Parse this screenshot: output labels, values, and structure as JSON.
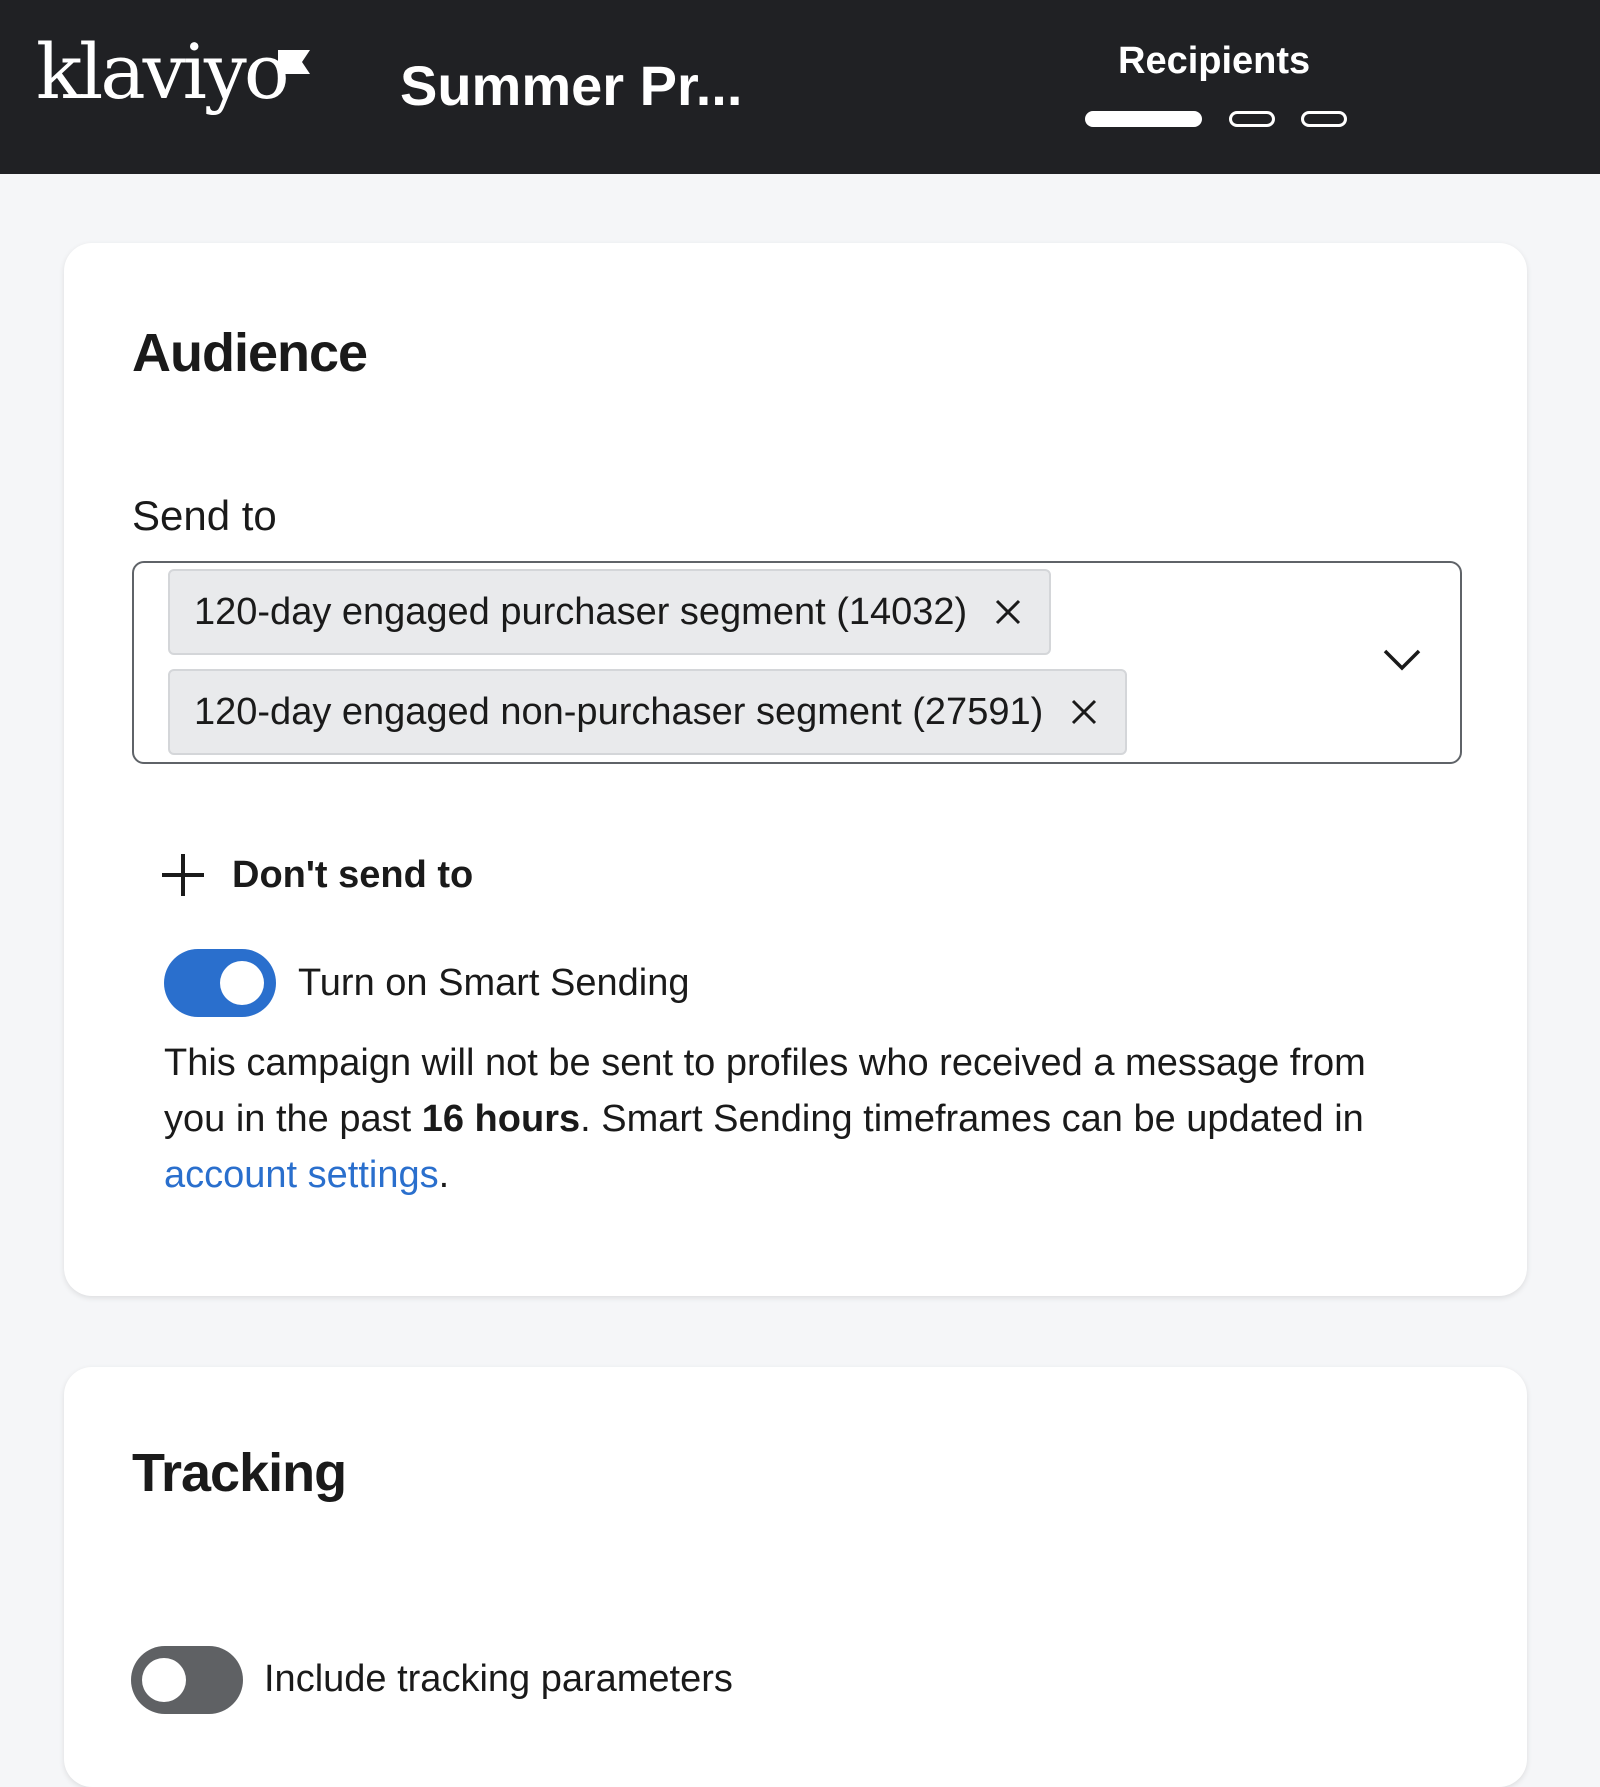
{
  "header": {
    "logo_text": "klaviyo",
    "campaign_title": "Summer Pr...",
    "current_step": "Recipients",
    "steps_total": 3,
    "steps_active": 1
  },
  "audience": {
    "title": "Audience",
    "send_to_label": "Send to",
    "selected_segments": [
      {
        "label": "120-day engaged purchaser segment (14032)"
      },
      {
        "label": "120-day engaged non-purchaser segment (27591)"
      }
    ],
    "dont_send_label": "Don't send to",
    "smart_sending": {
      "label": "Turn on Smart Sending",
      "enabled": true,
      "desc_part1": "This campaign will not be sent to profiles who received a message from you in the past ",
      "desc_bold": "16 hours",
      "desc_part2": ". Smart Sending timeframes can be updated in ",
      "link_text": "account settings",
      "desc_end": "."
    }
  },
  "tracking": {
    "title": "Tracking",
    "include_params": {
      "label": "Include tracking parameters",
      "enabled": false
    }
  },
  "colors": {
    "header_bg": "#202124",
    "accent": "#2a6fcd",
    "toggle_off": "#5f6164",
    "page_bg": "#f5f6f8"
  }
}
